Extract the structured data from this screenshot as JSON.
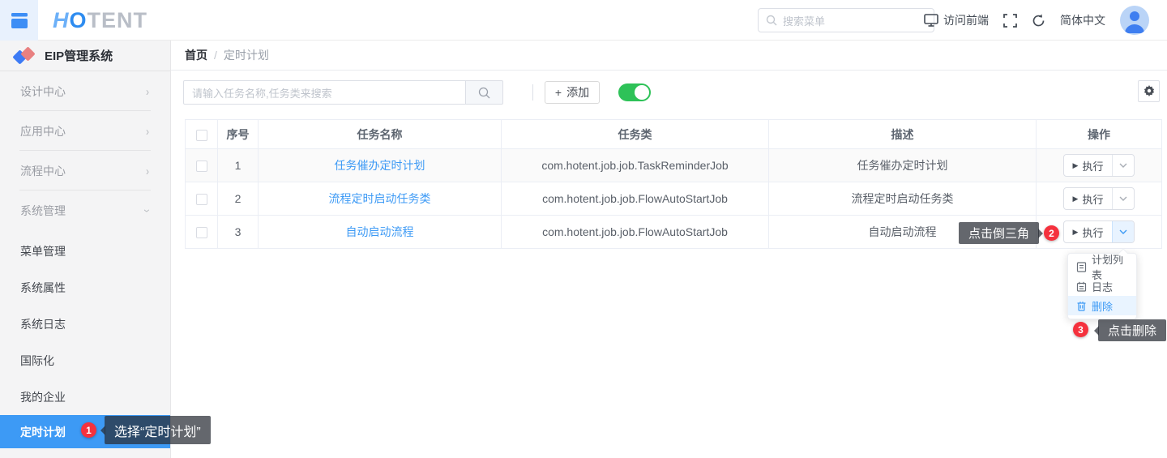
{
  "topbar": {
    "logo_part1": "H",
    "logo_part2": "O",
    "logo_part3": "TENT",
    "search_placeholder": "搜索菜单",
    "visit_frontend_label": "访问前端",
    "language_label": "简体中文"
  },
  "sidebar": {
    "system_title": "EIP管理系统",
    "groups": [
      {
        "label": "设计中心",
        "expanded": false
      },
      {
        "label": "应用中心",
        "expanded": false
      },
      {
        "label": "流程中心",
        "expanded": false
      },
      {
        "label": "系统管理",
        "expanded": true
      }
    ],
    "items": [
      {
        "label": "菜单管理",
        "active": false
      },
      {
        "label": "系统属性",
        "active": false
      },
      {
        "label": "系统日志",
        "active": false
      },
      {
        "label": "国际化",
        "active": false
      },
      {
        "label": "我的企业",
        "active": false
      },
      {
        "label": "定时计划",
        "active": true
      }
    ]
  },
  "breadcrumb": {
    "home": "首页",
    "separator": "/",
    "current": "定时计划"
  },
  "toolbar": {
    "search_placeholder": "请输入任务名称,任务类来搜索",
    "add_plus": "+",
    "add_label": "添加",
    "toggle_state": "on"
  },
  "table": {
    "headers": {
      "index": "序号",
      "name": "任务名称",
      "job_class": "任务类",
      "description": "描述",
      "actions": "操作"
    },
    "action_label": "执行",
    "rows": [
      {
        "num": "1",
        "name": "任务催办定时计划",
        "job_class": "com.hotent.job.job.TaskReminderJob",
        "desc": "任务催办定时计划",
        "open": false
      },
      {
        "num": "2",
        "name": "流程定时启动任务类",
        "job_class": "com.hotent.job.job.FlowAutoStartJob",
        "desc": "流程定时启动任务类",
        "open": false
      },
      {
        "num": "3",
        "name": "自动启动流程",
        "job_class": "com.hotent.job.job.FlowAutoStartJob",
        "desc": "自动启动流程",
        "open": true
      }
    ]
  },
  "dropdown": {
    "items": [
      {
        "label": "计划列表",
        "icon": "plan-list-icon",
        "active": false
      },
      {
        "label": "日志",
        "icon": "log-icon",
        "active": false
      },
      {
        "label": "删除",
        "icon": "trash-icon",
        "active": true
      }
    ]
  },
  "annotations": {
    "step1": {
      "badge": "1",
      "tooltip": "选择“定时计划”"
    },
    "step2": {
      "badge": "2",
      "tooltip": "点击倒三角"
    },
    "step3": {
      "badge": "3",
      "tooltip": "点击删除"
    }
  },
  "colors": {
    "accent": "#3d9af5",
    "toggle_on": "#2ec258",
    "badge_red": "#f5313d",
    "active_menu_bg": "#3d9af5",
    "link": "#3d9af5"
  }
}
